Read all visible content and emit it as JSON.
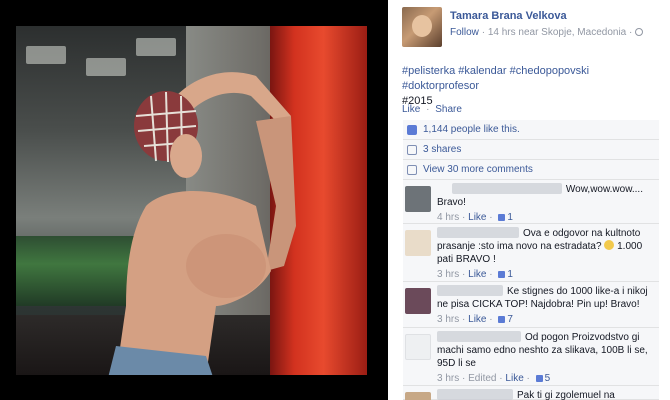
{
  "header": {
    "name": "Tamara Brana Velkova",
    "follow": "Follow",
    "time_location": "14 hrs near Skopje, Macedonia"
  },
  "post": {
    "tags": "#pelisterka #kalendar #chedopopovski #doktorprofesor",
    "tags_line2": "#2015"
  },
  "actions": {
    "like": "Like",
    "share": "Share",
    "separator": "·"
  },
  "ufi": {
    "likes": "1,144 people like this.",
    "shares": "3 shares",
    "more_comments": "View 30 more comments"
  },
  "comments": [
    {
      "text": "Wow,wow.wow....",
      "text2": "Bravo!",
      "time": "4 hrs",
      "like": "Like",
      "likes": "1",
      "avatar_color": "#6d7378"
    },
    {
      "text": "Ova e odgovor na kultnoto prasanje :sto ima novo na estradata?",
      "text_after": "1.000 pati BRAVO !",
      "time": "3 hrs",
      "like": "Like",
      "likes": "1",
      "avatar_color": "#e9dcc9"
    },
    {
      "text": "Ke stignes do 1000 like-a i nikoj ne pisa CICKA TOP! Najdobra! Pin up! Bravo!",
      "time": "3 hrs",
      "like": "Like",
      "likes": "7",
      "avatar_color": "#6b4a5a"
    },
    {
      "text": "Od pogon Proizvodstvo gi machi samo edno neshto za slikava, 100B li se, 95D li se",
      "time": "3 hrs",
      "edited": "Edited",
      "like": "Like",
      "likes": "5",
      "avatar_color": "#eef0f2"
    },
    {
      "text": "Pak ti gi zgolemuel na",
      "avatar_color": "#c7a886"
    }
  ],
  "meta_separator": "·"
}
